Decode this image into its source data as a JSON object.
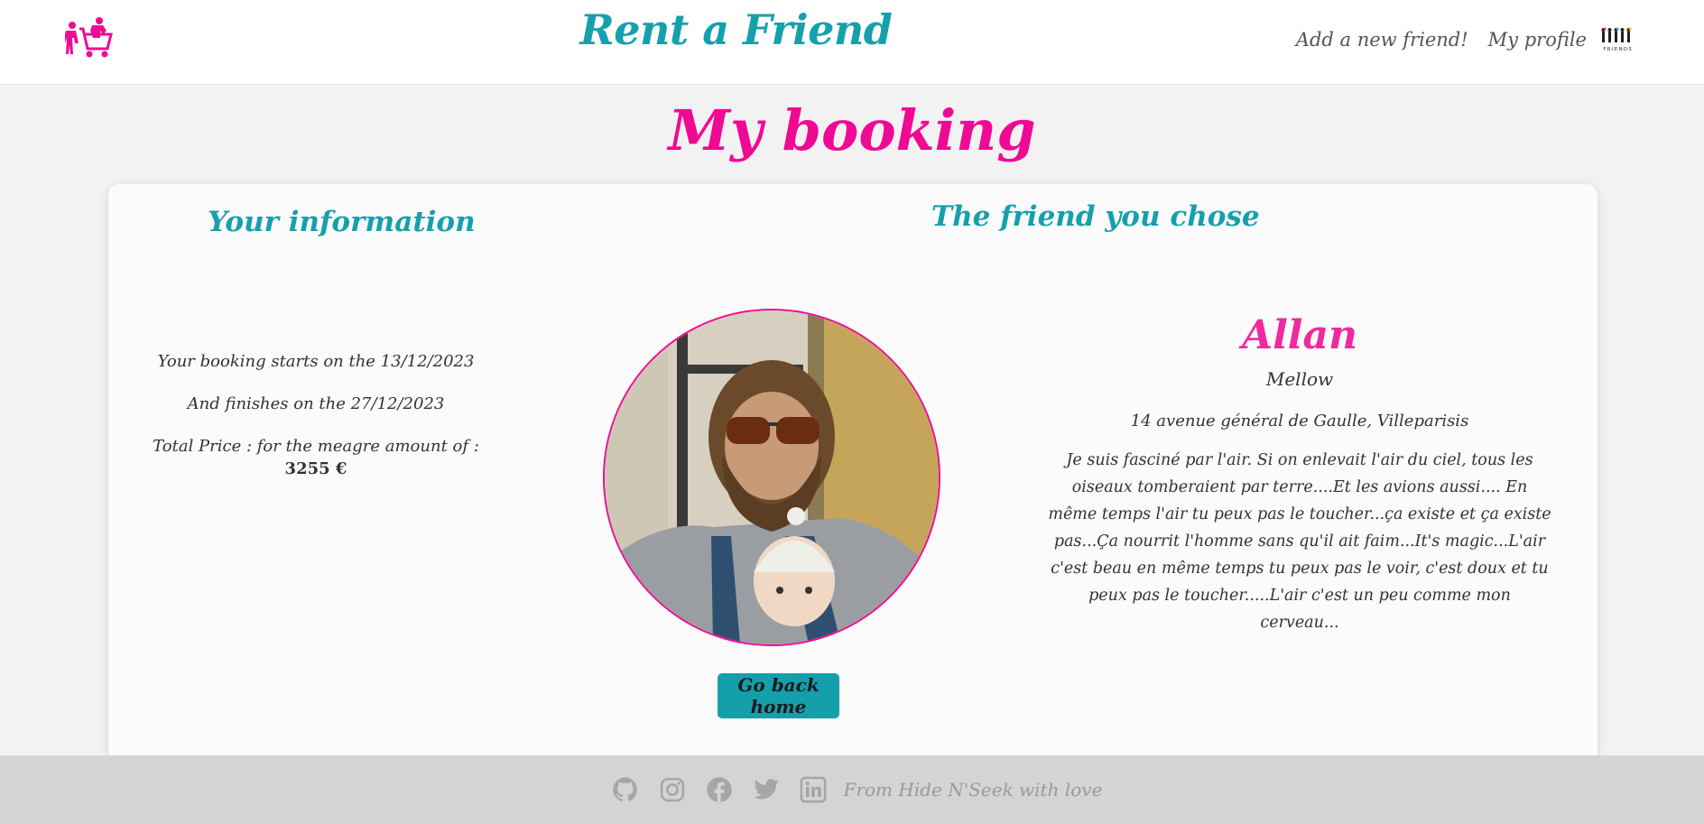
{
  "header": {
    "brand": "Rent a Friend",
    "nav_add_friend": "Add a new friend!",
    "nav_profile": "My profile",
    "friends_logo_text": "F·R·I·E·N·D·S"
  },
  "page": {
    "title": "My booking"
  },
  "your_info": {
    "title": "Your information",
    "start_text": "Your booking starts on the 13/12/2023",
    "end_text": "And finishes on the 27/12/2023",
    "price_label": "Total Price : for the meagre amount of :",
    "price_value": "3255 €"
  },
  "friend": {
    "section_title": "The friend you chose",
    "name": "Allan",
    "mood": "Mellow",
    "address": "14 avenue général de Gaulle, Villeparisis",
    "description": "Je suis fasciné par l'air. Si on enlevait l'air du ciel, tous les oiseaux tomberaient par terre....Et les avions aussi.... En même temps l'air tu peux pas le toucher...ça existe et ça existe pas...Ça nourrit l'homme sans qu'il ait faim...It's magic...L'air c'est beau en même temps tu peux pas le voir, c'est doux et tu peux pas le toucher.....L'air c'est un peu comme mon cerveau..."
  },
  "actions": {
    "back_home": "Go back home"
  },
  "footer": {
    "text": "From Hide N'Seek with love",
    "icons": [
      "github-icon",
      "instagram-icon",
      "facebook-icon",
      "twitter-icon",
      "linkedin-icon"
    ]
  },
  "colors": {
    "brand_teal": "#16a0ad",
    "accent_pink": "#ef0a94",
    "footer_bg": "#d4d4d4"
  }
}
